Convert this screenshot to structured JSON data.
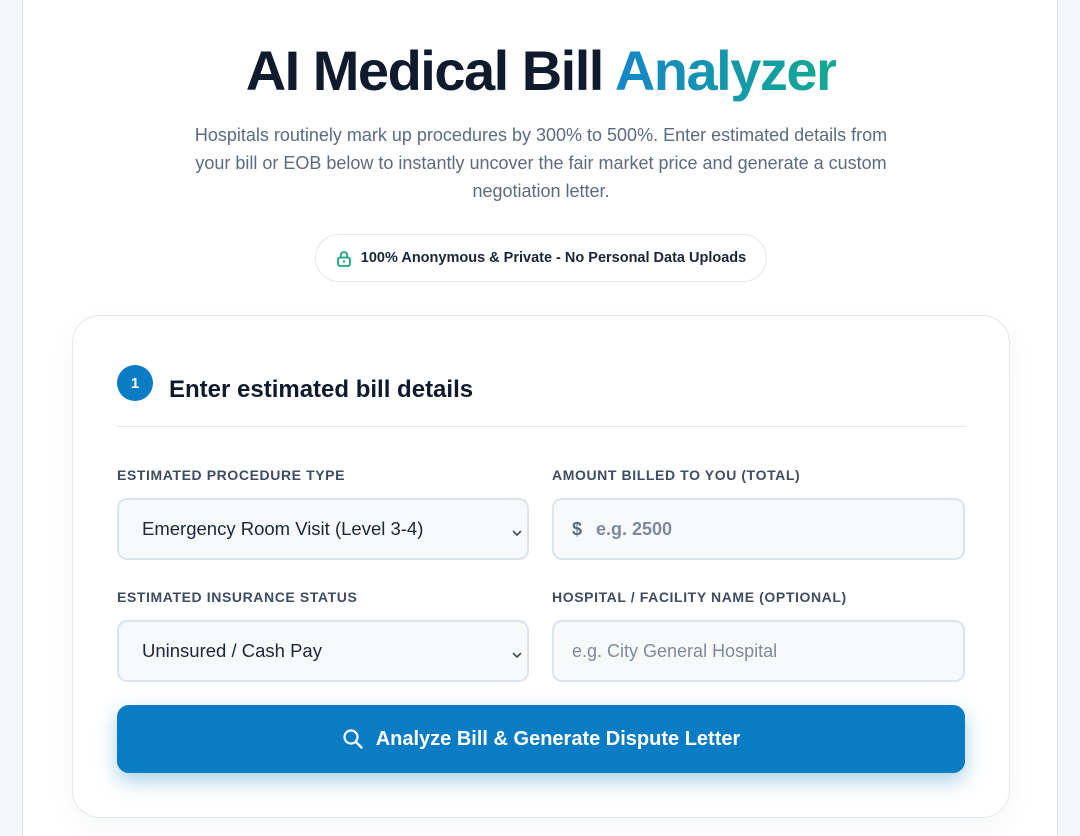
{
  "header": {
    "title_main": "AI Medical Bill",
    "title_accent": "Analyzer",
    "subtitle": "Hospitals routinely mark up procedures by 300% to 500%. Enter estimated details from your bill or EOB below to instantly uncover the fair market price and generate a custom negotiation letter.",
    "privacy_badge": "100% Anonymous & Private - No Personal Data Uploads"
  },
  "form": {
    "step_number": "1",
    "step_title": "Enter estimated bill details",
    "procedure": {
      "label": "ESTIMATED PROCEDURE TYPE",
      "selected": "Emergency Room Visit (Level 3-4)"
    },
    "amount": {
      "label": "AMOUNT BILLED TO YOU (TOTAL)",
      "currency": "$",
      "placeholder": "e.g. 2500"
    },
    "insurance": {
      "label": "ESTIMATED INSURANCE STATUS",
      "selected": "Uninsured / Cash Pay"
    },
    "hospital": {
      "label": "HOSPITAL / FACILITY NAME (OPTIONAL)",
      "placeholder": "e.g. City General Hospital"
    },
    "submit_label": "Analyze Bill & Generate Dispute Letter"
  },
  "icons": {
    "privacy": "lock-icon",
    "submit": "search-icon",
    "dropdown": "chevron-down-icon"
  },
  "colors": {
    "primary": "#0a7cc4",
    "accent_gradient_start": "#1586c9",
    "accent_gradient_end": "#14a98f",
    "lock_icon": "#18a57c",
    "heading": "#0f1b2d"
  }
}
